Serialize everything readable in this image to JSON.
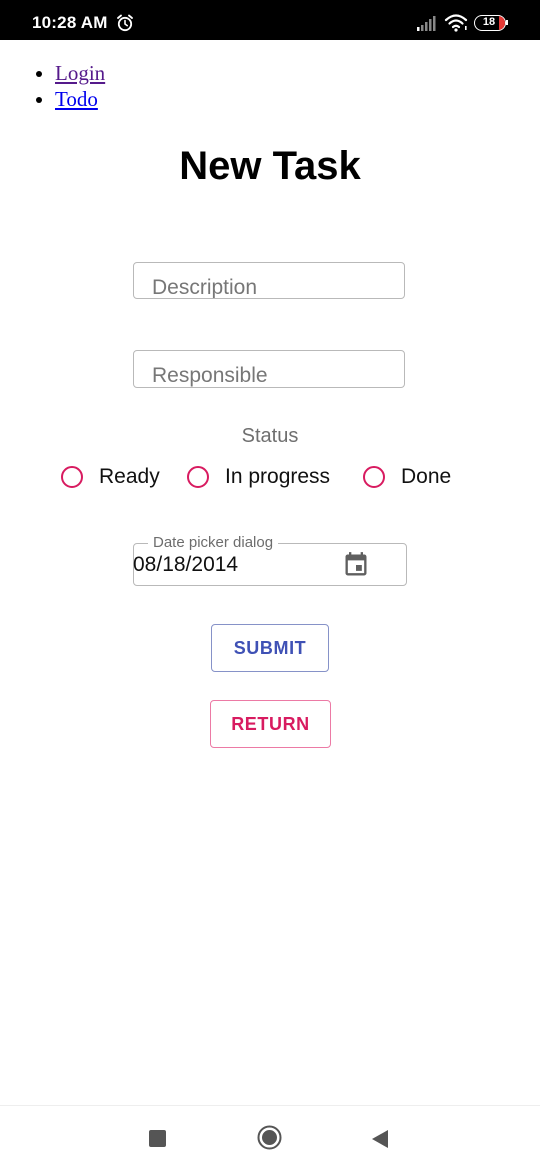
{
  "status_bar": {
    "time": "10:28 AM",
    "battery_level": "18",
    "icons": [
      "alarm-icon",
      "signal-icon",
      "wifi-icon",
      "battery-icon"
    ]
  },
  "nav": {
    "links": [
      {
        "label": "Login"
      },
      {
        "label": "Todo"
      }
    ]
  },
  "page": {
    "title": "New Task"
  },
  "form": {
    "description": {
      "placeholder": "Description",
      "value": ""
    },
    "responsible": {
      "placeholder": "Responsible",
      "value": ""
    },
    "status": {
      "label": "Status",
      "options": [
        {
          "label": "Ready",
          "selected": false
        },
        {
          "label": "In progress",
          "selected": false
        },
        {
          "label": "Done",
          "selected": false
        }
      ]
    },
    "date_picker": {
      "label": "Date picker dialog",
      "value": "08/18/2014",
      "icon": "calendar-icon"
    },
    "submit_label": "SUBMIT",
    "return_label": "RETURN"
  },
  "colors": {
    "radio_accent": "#d81b60",
    "submit_text": "#3f51b5",
    "return_text": "#d81b60",
    "visited_link": "#551a8b",
    "unvisited_link": "#0000ee"
  },
  "system_nav": {
    "icons": [
      "recents-icon",
      "home-icon",
      "back-icon"
    ]
  }
}
